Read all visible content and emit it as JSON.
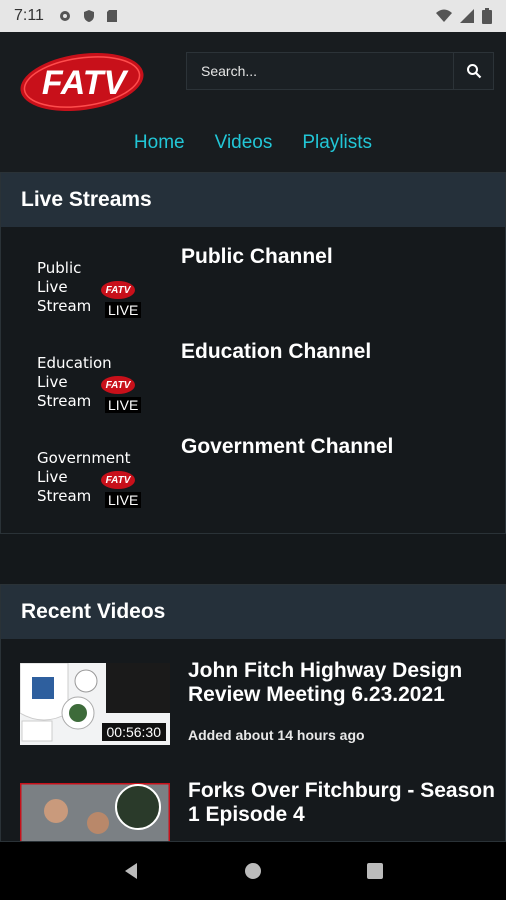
{
  "status_bar": {
    "time": "7:11"
  },
  "header": {
    "logo_text": "FATV",
    "search": {
      "placeholder": "Search..."
    },
    "nav": [
      {
        "label": "Home"
      },
      {
        "label": "Videos"
      },
      {
        "label": "Playlists"
      }
    ]
  },
  "live_streams": {
    "heading": "Live Streams",
    "items": [
      {
        "thumb_text": "Public\nLive\nStream",
        "badge": "FATV",
        "badge_live": "LIVE",
        "name": "Public Channel"
      },
      {
        "thumb_text": "Education\nLive\nStream",
        "badge": "FATV",
        "badge_live": "LIVE",
        "name": "Education Channel"
      },
      {
        "thumb_text": "Government\nLive\nStream",
        "badge": "FATV",
        "badge_live": "LIVE",
        "name": "Government Channel"
      }
    ]
  },
  "recent_videos": {
    "heading": "Recent Videos",
    "items": [
      {
        "title": "John Fitch Highway Design Review Meeting 6.23.2021",
        "duration": "00:56:30",
        "added": "Added about 14 hours ago"
      },
      {
        "title": "Forks Over Fitchburg - Season 1 Episode 4",
        "duration": "",
        "added": ""
      }
    ]
  },
  "colors": {
    "accent": "#22c6d6",
    "panel_header": "#25303a",
    "background": "#14181b",
    "brand_red": "#c8101a"
  }
}
